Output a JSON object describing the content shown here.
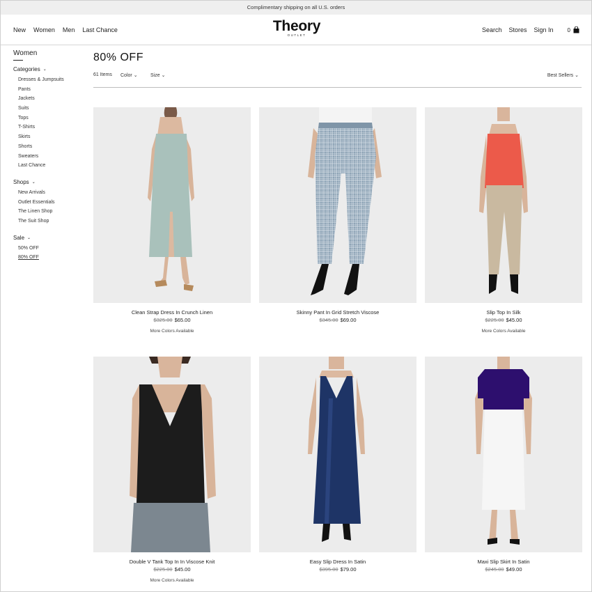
{
  "promo": "Complimentary shipping on all U.S. orders",
  "nav_left": [
    "New",
    "Women",
    "Men",
    "Last Chance"
  ],
  "logo": {
    "main": "Theory",
    "sub": "OUTLET"
  },
  "nav_right": {
    "search": "Search",
    "stores": "Stores",
    "signin": "Sign In",
    "bag_count": "0"
  },
  "sidebar": {
    "title": "Women",
    "categories_label": "Categories",
    "categories": [
      "Dresses & Jumpsuits",
      "Pants",
      "Jackets",
      "Suits",
      "Tops",
      "T-Shirts",
      "Skirts",
      "Shorts",
      "Sweaters",
      "Last Chance"
    ],
    "shops_label": "Shops",
    "shops": [
      "New Arrivals",
      "Outlet Essentials",
      "The Linen Shop",
      "The Suit Shop"
    ],
    "sale_label": "Sale",
    "sale": [
      "50% OFF",
      "80% OFF"
    ]
  },
  "page_title": "80% OFF",
  "filters": {
    "count": "61 Items",
    "color": "Color",
    "size": "Size",
    "sort": "Best Sellers"
  },
  "products": [
    {
      "name": "Clean Strap Dress In Crunch Linen",
      "orig": "$325.00",
      "price": "$65.00",
      "more": "More Colors Available"
    },
    {
      "name": "Skinny Pant In Grid Stretch Viscose",
      "orig": "$345.00",
      "price": "$69.00",
      "more": ""
    },
    {
      "name": "Slip Top In Silk",
      "orig": "$225.00",
      "price": "$45.00",
      "more": "More Colors Available"
    },
    {
      "name": "Double V Tank Top In In Viscose Knit",
      "orig": "$225.00",
      "price": "$45.00",
      "more": "More Colors Available"
    },
    {
      "name": "Easy Slip Dress In Satin",
      "orig": "$395.00",
      "price": "$79.00",
      "more": ""
    },
    {
      "name": "Maxi Slip Skirt In Satin",
      "orig": "$245.00",
      "price": "$49.00",
      "more": ""
    }
  ],
  "colors": {
    "promo_bg": "#efefef",
    "image_bg": "#ececec"
  }
}
